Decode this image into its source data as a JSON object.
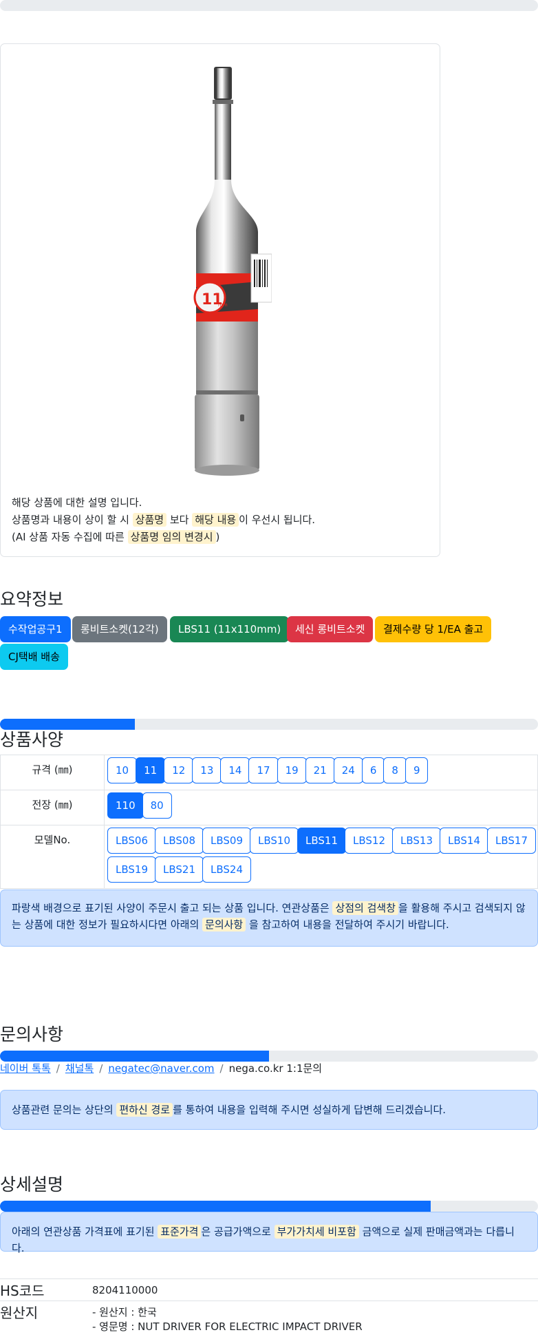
{
  "product_card": {
    "image_label": "11mm",
    "description_line1": "해당 상품에 대한 설명 입니다.",
    "line2_pre": "상품명과 내용이 상이 할 시 ",
    "line2_hl1": "상품명",
    "line2_mid": " 보다 ",
    "line2_hl2": "해당 내용",
    "line2_post": "이 우선시 됩니다.",
    "line3_pre": "(AI 상품 자동 수집에 따른 ",
    "line3_hl": "상품명 임의 변경시",
    "line3_post": ")"
  },
  "summary": {
    "title": "요약정보",
    "badges": [
      {
        "label": "수작업공구1",
        "color": "#0d6efd"
      },
      {
        "label": "롱비트소켓(12각)",
        "color": "#6c757d"
      },
      {
        "label": "LBS11 (11x110mm)",
        "color": "#198754"
      },
      {
        "label": "세신 롱비트소켓",
        "color": "#dc3545"
      },
      {
        "label": "결제수량 당 1/EA 출고",
        "color": "#ffc107"
      },
      {
        "label": "CJ택배 배송",
        "color": "#0dcaf0"
      }
    ],
    "progress_percent": 25
  },
  "specs": {
    "title": "상품사양",
    "rows": [
      {
        "label": "규격 (㎜)",
        "options": [
          "10",
          "11",
          "12",
          "13",
          "14",
          "17",
          "19",
          "21",
          "24",
          "6",
          "8",
          "9"
        ],
        "selected": "11"
      },
      {
        "label": "전장 (㎜)",
        "options": [
          "110",
          "80"
        ],
        "selected": "110"
      },
      {
        "label": "모델No.",
        "options": [
          "LBS06",
          "LBS08",
          "LBS09",
          "LBS10",
          "LBS11",
          "LBS12",
          "LBS13",
          "LBS14",
          "LBS17",
          "LBS19",
          "LBS21",
          "LBS24"
        ],
        "selected": "LBS11"
      }
    ],
    "notice_pre": "파랑색 배경으로 표기된 사양이 주문시 출고 되는 상품 입니다. 연관상품은 ",
    "notice_hl1": "상점의 검색창",
    "notice_mid": "을 활용해 주시고 검색되지 않는 상품에 대한 정보가 필요하시다면 아래의 ",
    "notice_hl2": "문의사항",
    "notice_post": " 을 참고하여 내용을 전달하여 주시기 바랍니다."
  },
  "inquiry": {
    "title": "문의사항",
    "progress_percent": 50,
    "links": [
      "네이버 톡톡",
      "채널톡",
      "negatec@naver.com"
    ],
    "plain": "nega.co.kr 1:1문의",
    "notice_pre": "상품관련 문의는 상단의 ",
    "notice_hl": "편하신 경로",
    "notice_post": "를 통하여 내용을 입력해 주시면 성실하게 답변해 드리겠습니다."
  },
  "detail": {
    "title": "상세설명",
    "progress_percent": 80,
    "notice_pre": "아래의 연관상품 가격표에 표기된 ",
    "notice_hl1": "표준가격",
    "notice_mid": "은 공급가액으로 ",
    "notice_hl2": "부가가치세 비포함",
    "notice_post": " 금액으로 실제 판매금액과는 다릅니다."
  },
  "info": {
    "hs_label": "HS코드",
    "hs_value": "8204110000",
    "origin_label": "원산지",
    "origin_line1": "- 원산지 : 한국",
    "origin_line2": "- 영문명 : NUT DRIVER FOR ELECTRIC IMPACT DRIVER"
  }
}
